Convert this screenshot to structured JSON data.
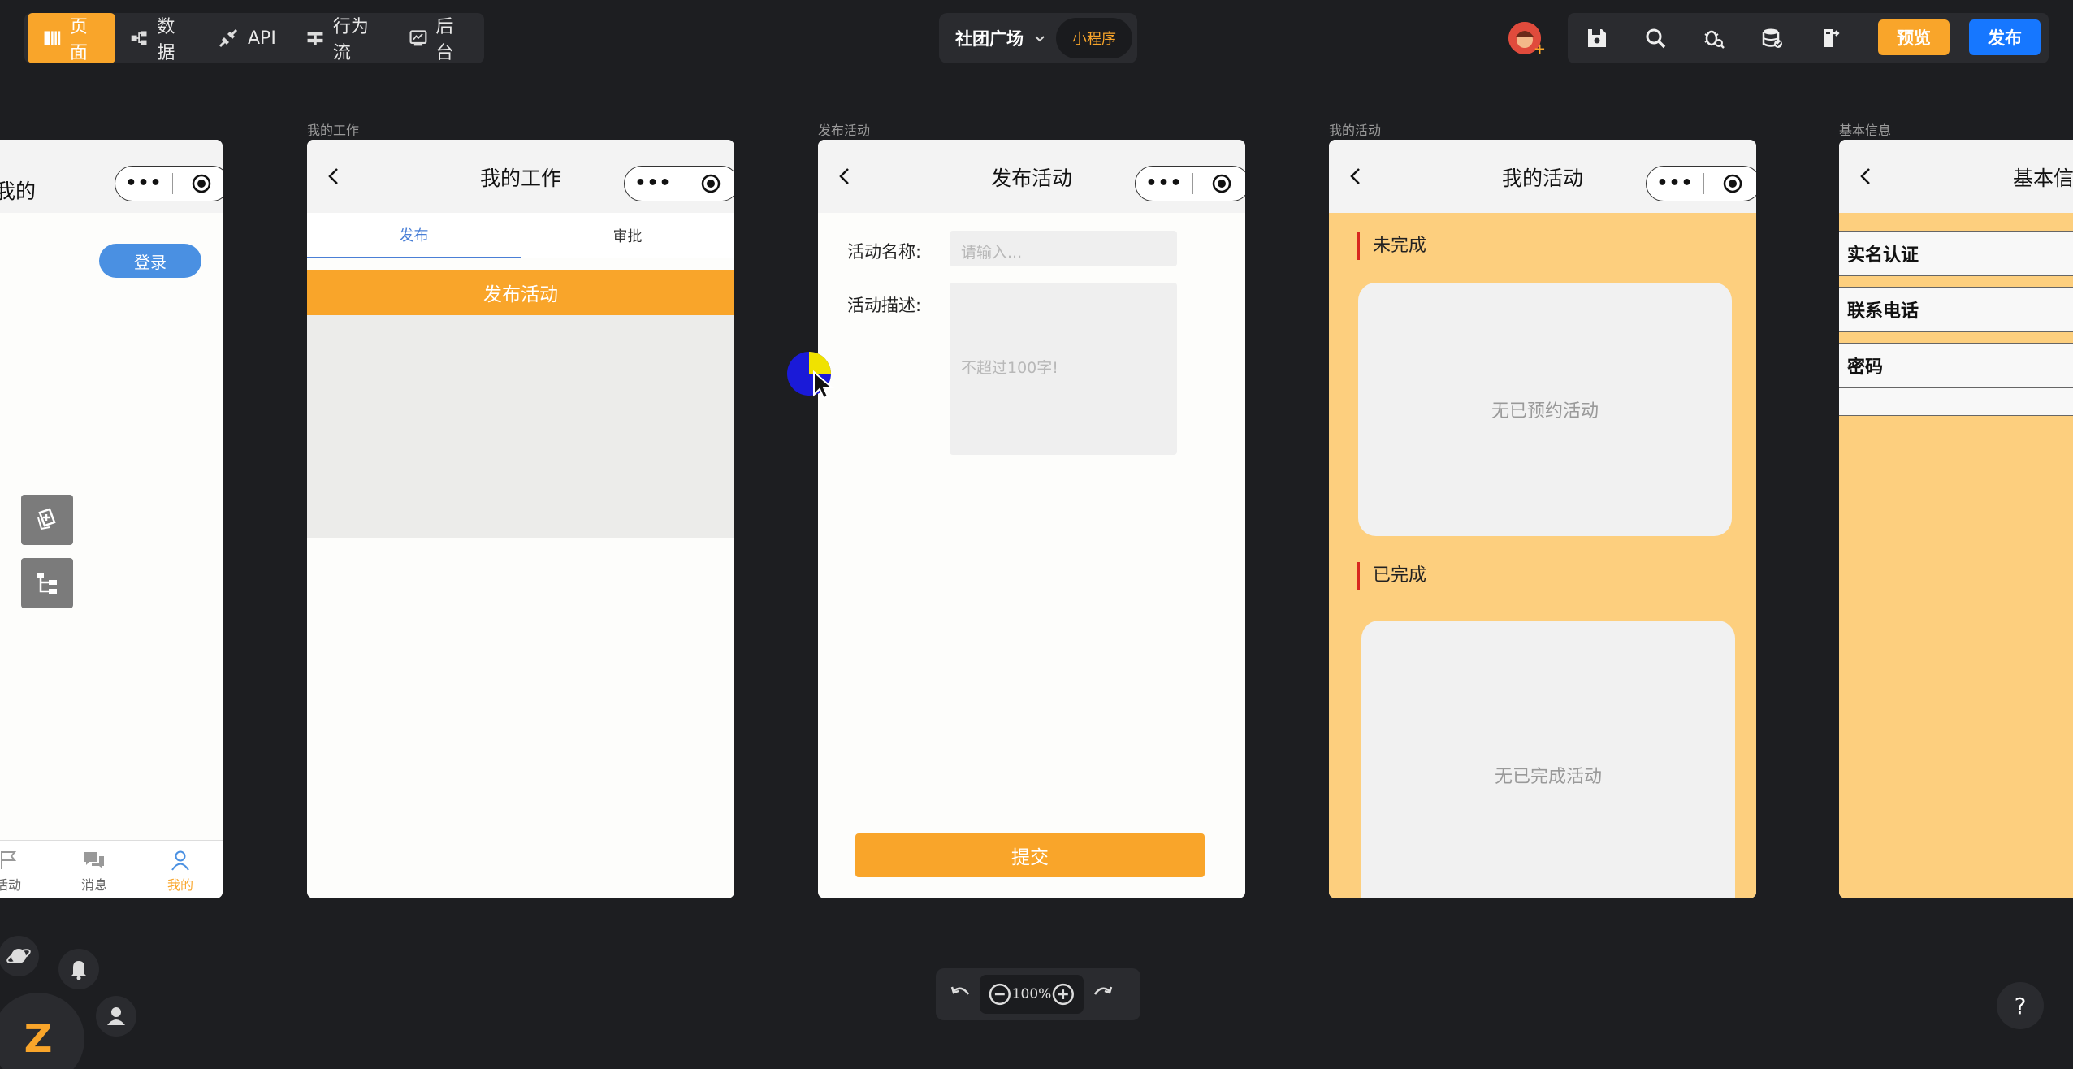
{
  "nav": {
    "items": [
      {
        "label": "页面",
        "icon": "page-icon",
        "active": true
      },
      {
        "label": "数据",
        "icon": "data-icon",
        "active": false
      },
      {
        "label": "API",
        "icon": "api-icon",
        "active": false
      },
      {
        "label": "行为流",
        "icon": "flow-icon",
        "active": false
      },
      {
        "label": "后台",
        "icon": "admin-icon",
        "active": false
      }
    ]
  },
  "project": {
    "name": "社团广场",
    "badge": "小程序"
  },
  "toolbar": {
    "preview_label": "预览",
    "publish_label": "发布"
  },
  "frames": [
    {
      "label": "",
      "title": "我的",
      "login_label": "登录",
      "tabbar": [
        "活动",
        "消息",
        "我的"
      ]
    },
    {
      "label": "我的工作",
      "title": "我的工作",
      "tabs": [
        "发布",
        "审批"
      ],
      "action_label": "发布活动"
    },
    {
      "label": "发布活动",
      "title": "发布活动",
      "fields": [
        {
          "label": "活动名称:",
          "placeholder": "请输入..."
        },
        {
          "label": "活动描述:",
          "placeholder": "不超过100字!"
        }
      ],
      "submit_label": "提交"
    },
    {
      "label": "我的活动",
      "title": "我的活动",
      "sections": [
        {
          "title": "未完成",
          "empty": "无已预约活动"
        },
        {
          "title": "已完成",
          "empty": "无已完成活动"
        }
      ]
    },
    {
      "label": "基本信息",
      "title": "基本信",
      "rows": [
        "实名认证",
        "联系电话",
        "密码"
      ]
    }
  ],
  "zoom": {
    "level": "100%"
  },
  "help": "?",
  "logo": "Z",
  "colors": {
    "accent": "#f9a52a",
    "primary": "#1677ff",
    "tab_active": "#4a7fd6",
    "section_marker": "#d8281f",
    "activity_bg": "#fdcf7e"
  }
}
